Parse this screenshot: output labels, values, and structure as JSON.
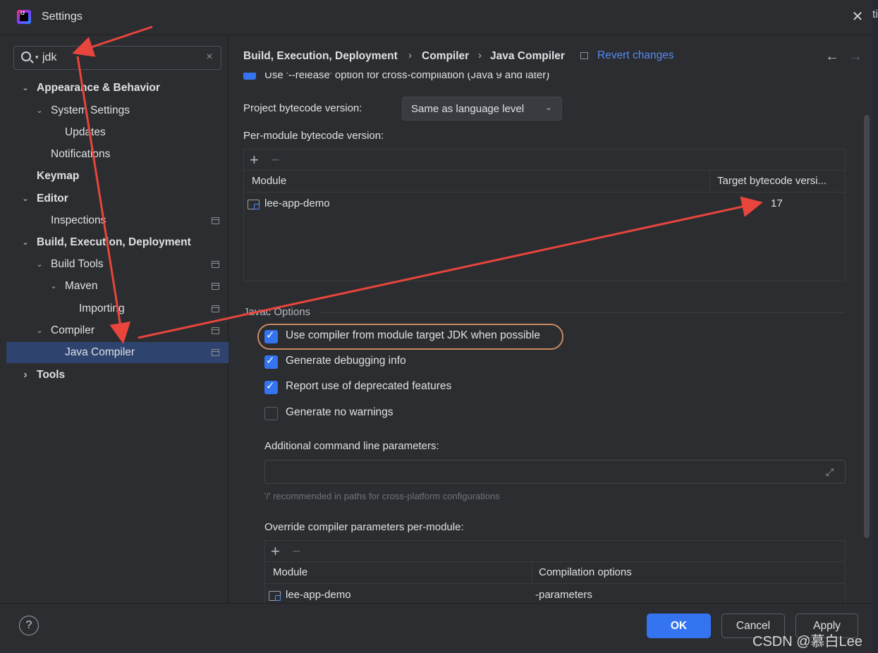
{
  "window": {
    "title": "Settings",
    "app_icon": "intellij-idea-logo",
    "bg_edge_text": "ti"
  },
  "search": {
    "value": "jdk",
    "placeholder": ""
  },
  "tree": [
    {
      "label": "Appearance & Behavior",
      "level": 0,
      "expanded": true,
      "bold": true
    },
    {
      "label": "System Settings",
      "level": 1,
      "expanded": true
    },
    {
      "label": "Updates",
      "level": 2
    },
    {
      "label": "Notifications",
      "level": 1
    },
    {
      "label": "Keymap",
      "level": 0,
      "bold": true
    },
    {
      "label": "Editor",
      "level": 0,
      "expanded": true,
      "bold": true
    },
    {
      "label": "Inspections",
      "level": 1,
      "page_icon": true
    },
    {
      "label": "Build, Execution, Deployment",
      "level": 0,
      "expanded": true,
      "bold": true
    },
    {
      "label": "Build Tools",
      "level": 1,
      "expanded": true,
      "page_icon": true
    },
    {
      "label": "Maven",
      "level": 2,
      "expanded": true,
      "page_icon": true
    },
    {
      "label": "Importing",
      "level": 3,
      "page_icon": true
    },
    {
      "label": "Compiler",
      "level": 1,
      "expanded": true,
      "page_icon": true
    },
    {
      "label": "Java Compiler",
      "level": 2,
      "selected": true,
      "page_icon": true
    },
    {
      "label": "Tools",
      "level": 0,
      "collapsed": true,
      "bold": true
    }
  ],
  "breadcrumb": [
    "Build, Execution, Deployment",
    "Compiler",
    "Java Compiler"
  ],
  "revert_label": "Revert changes",
  "release_option_label": "Use '--release' option for cross-compilation (Java 9 and later)",
  "project_bytecode": {
    "label": "Project bytecode version:",
    "value": "Same as language level"
  },
  "per_module": {
    "label": "Per-module bytecode version:",
    "columns": [
      "Module",
      "Target bytecode versi..."
    ],
    "rows": [
      {
        "module": "lee-app-demo",
        "target": "17"
      }
    ]
  },
  "javac": {
    "section_title": "Javac Options",
    "options": [
      {
        "label": "Use compiler from module target JDK when possible",
        "checked": true
      },
      {
        "label": "Generate debugging info",
        "checked": true
      },
      {
        "label": "Report use of deprecated features",
        "checked": true
      },
      {
        "label": "Generate no warnings",
        "checked": false
      }
    ],
    "additional_label": "Additional command line parameters:",
    "additional_value": "",
    "hint": "'/' recommended in paths for cross-platform configurations",
    "override_label": "Override compiler parameters per-module:",
    "override_columns": [
      "Module",
      "Compilation options"
    ],
    "override_rows": [
      {
        "module": "lee-app-demo",
        "options": "-parameters"
      }
    ]
  },
  "buttons": {
    "ok": "OK",
    "cancel": "Cancel",
    "apply": "Apply",
    "help": "?"
  },
  "watermark": "CSDN @慕白Lee",
  "colors": {
    "accent": "#3574f0",
    "link": "#548af7",
    "annotation_arrow": "#e8453c",
    "highlight_ring": "#c98a62",
    "selection": "#2e436e"
  }
}
